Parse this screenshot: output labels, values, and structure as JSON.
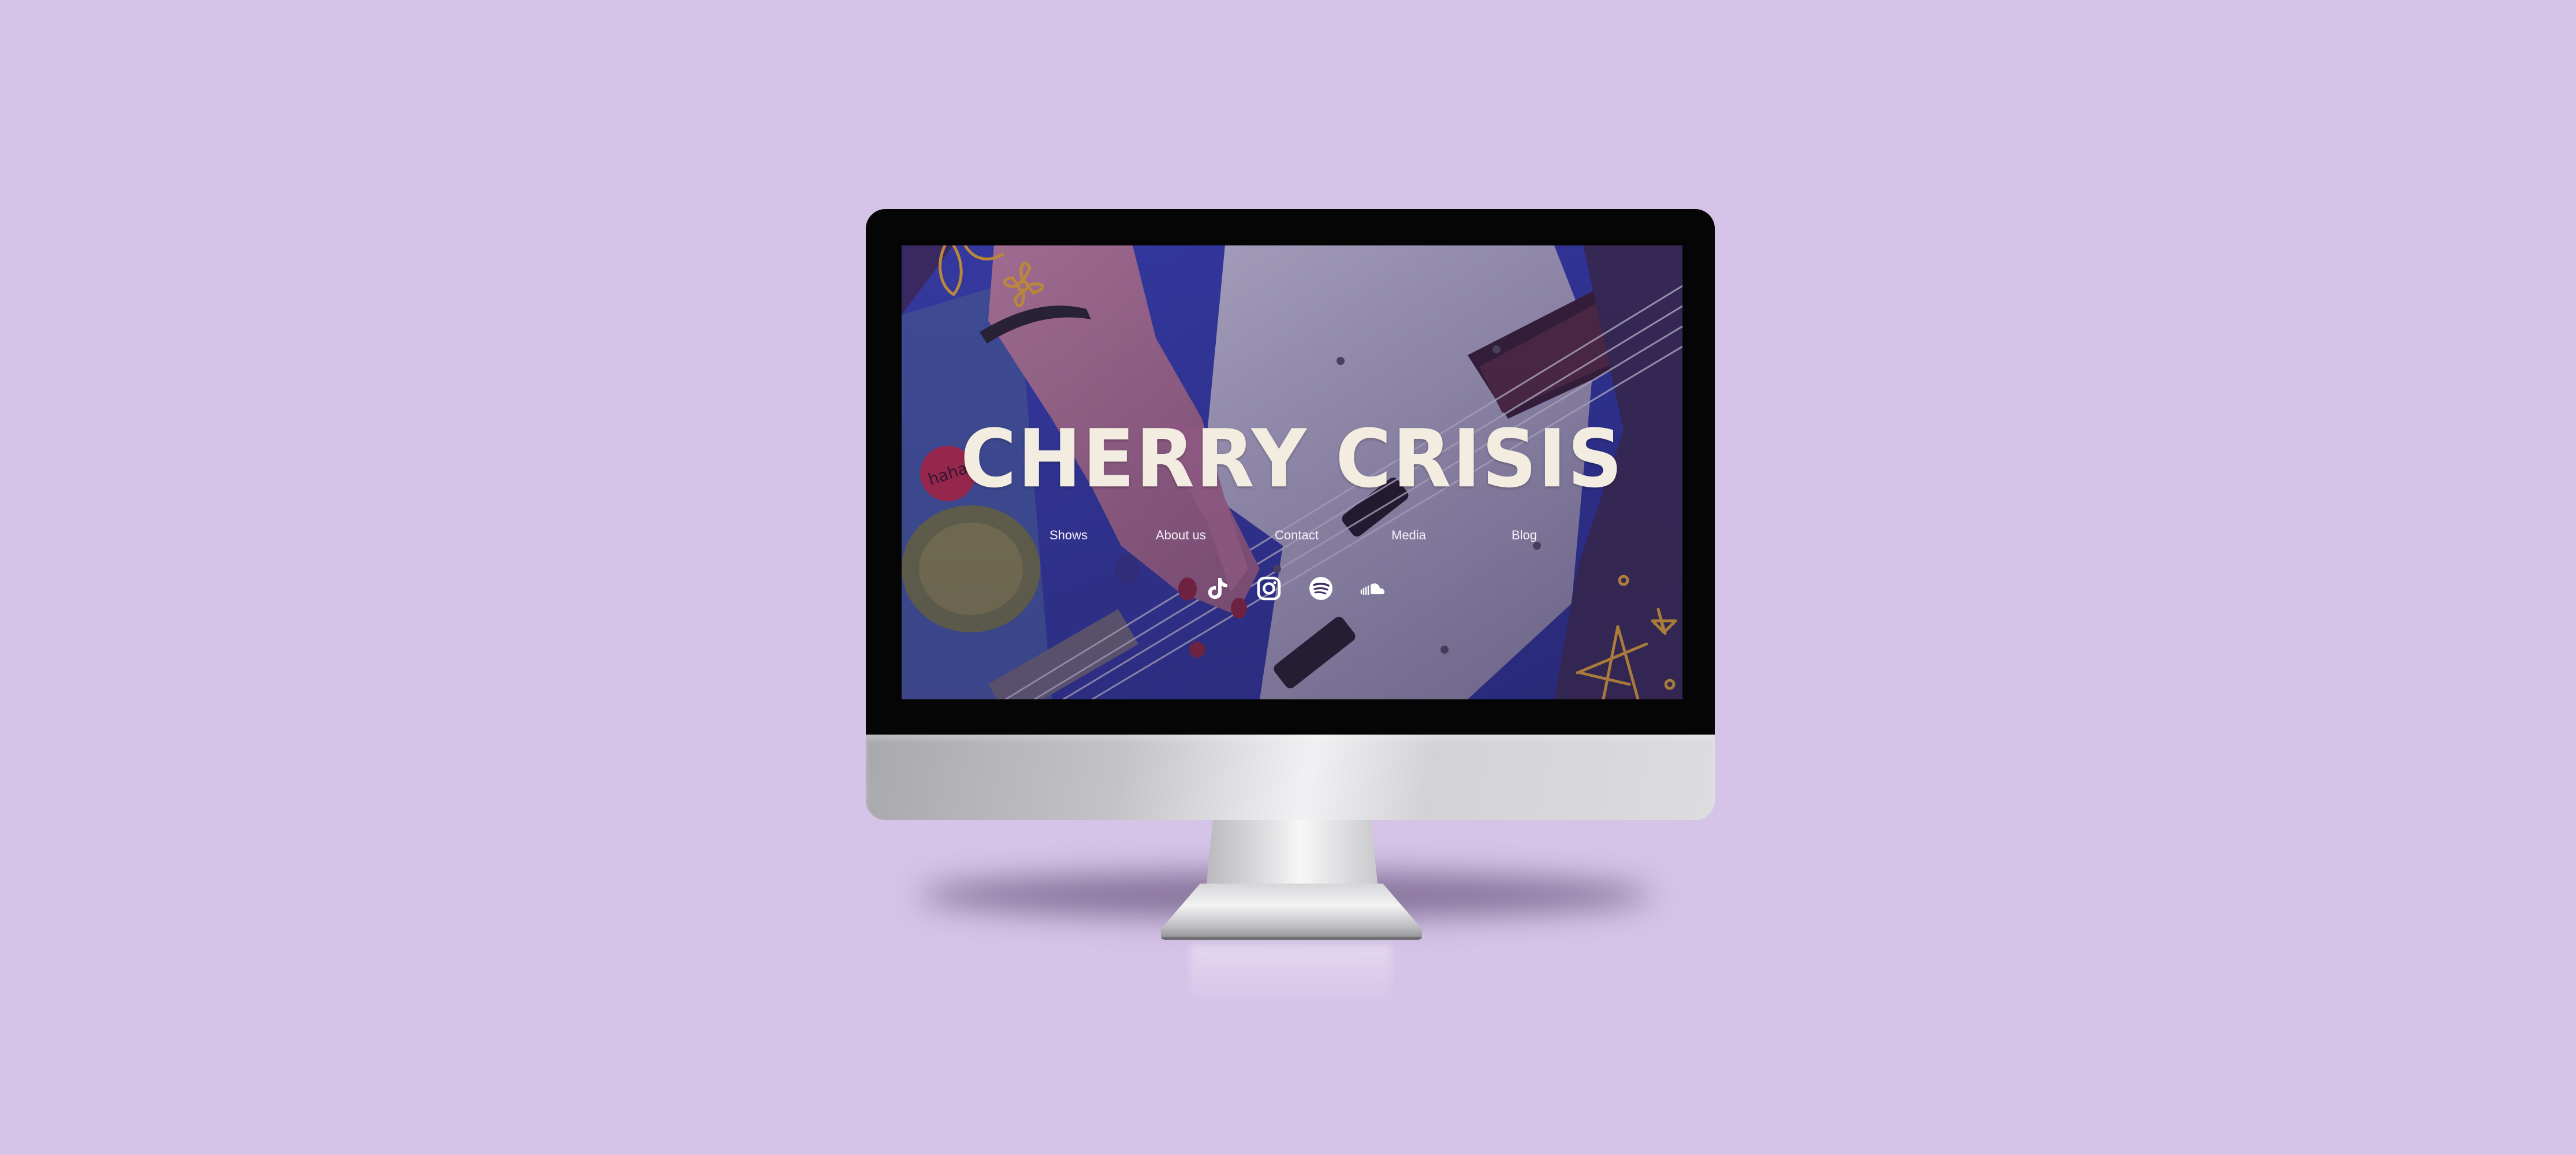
{
  "site": {
    "title": "CHERRY CRISIS",
    "sticker_text": "haha"
  },
  "nav": {
    "items": [
      {
        "label": "Shows"
      },
      {
        "label": "About us"
      },
      {
        "label": "Contact"
      },
      {
        "label": "Media"
      },
      {
        "label": "Blog"
      }
    ]
  },
  "socials": [
    {
      "icon": "tiktok-icon"
    },
    {
      "icon": "instagram-icon"
    },
    {
      "icon": "spotify-icon"
    },
    {
      "icon": "soundcloud-icon"
    }
  ],
  "colors": {
    "page_background": "#d5c3e8",
    "title_text": "#f3ece1",
    "nav_text": "#f4eef9",
    "doodle_accent": "#f2b51f"
  }
}
